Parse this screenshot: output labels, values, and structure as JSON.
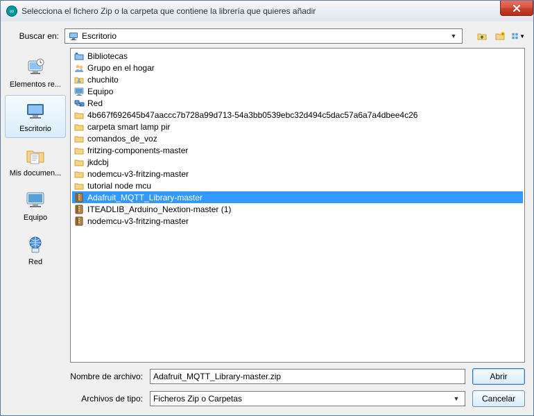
{
  "window": {
    "title": "Selecciona el fichero Zip o la carpeta que contiene la librería que quieres añadir"
  },
  "lookin": {
    "label": "Buscar en:",
    "value": "Escritorio"
  },
  "places": [
    {
      "key": "recent",
      "label": "Elementos re..."
    },
    {
      "key": "desktop",
      "label": "Escritorio",
      "active": true
    },
    {
      "key": "documents",
      "label": "Mis documen..."
    },
    {
      "key": "computer",
      "label": "Equipo"
    },
    {
      "key": "network",
      "label": "Red"
    }
  ],
  "files": [
    {
      "icon": "library",
      "name": "Bibliotecas"
    },
    {
      "icon": "homegroup",
      "name": "Grupo en el hogar"
    },
    {
      "icon": "folder-user",
      "name": "chuchito"
    },
    {
      "icon": "computer",
      "name": "Equipo"
    },
    {
      "icon": "network",
      "name": "Red"
    },
    {
      "icon": "folder",
      "name": "4b667f692645b47aaccc7b728a99d713-54a3bb0539ebc32d494c5dac57a6a7a4dbee4c26"
    },
    {
      "icon": "folder",
      "name": "carpeta smart lamp pir"
    },
    {
      "icon": "folder",
      "name": "comandos_de_voz"
    },
    {
      "icon": "folder",
      "name": "fritzing-components-master"
    },
    {
      "icon": "folder",
      "name": "jkdcbj"
    },
    {
      "icon": "folder",
      "name": "nodemcu-v3-fritzing-master"
    },
    {
      "icon": "folder",
      "name": "tutorial node mcu"
    },
    {
      "icon": "zip",
      "name": "Adafruit_MQTT_Library-master",
      "selected": true
    },
    {
      "icon": "zip",
      "name": "ITEADLIB_Arduino_Nextion-master (1)"
    },
    {
      "icon": "zip",
      "name": "nodemcu-v3-fritzing-master"
    }
  ],
  "filename": {
    "label": "Nombre de archivo:",
    "value": "Adafruit_MQTT_Library-master.zip"
  },
  "filetype": {
    "label": "Archivos de tipo:",
    "value": "Ficheros Zip o Carpetas"
  },
  "buttons": {
    "open": "Abrir",
    "cancel": "Cancelar"
  }
}
